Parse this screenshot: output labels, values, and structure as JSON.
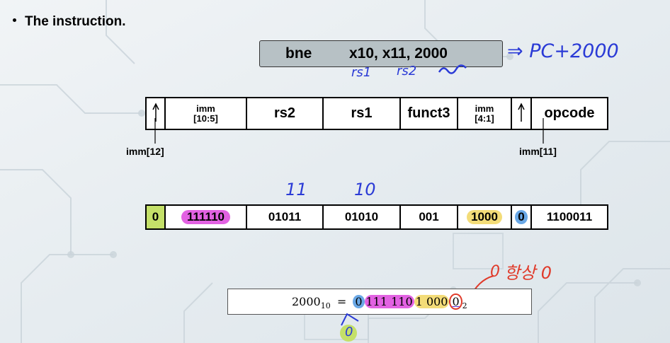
{
  "title": "The instruction.",
  "instruction": {
    "opcode": "bne",
    "operands": "x10, x11, 2000"
  },
  "annotations": {
    "pc_note": "⇒ PC+2000",
    "rs1_note": "rs1",
    "rs2_note": "rs2",
    "reg11_note": "11",
    "reg10_note": "10",
    "always_zero_note": "항상 0",
    "zero_hand": "0",
    "zero_hand_lower": "0"
  },
  "format": {
    "fields": [
      {
        "label": "",
        "arrow": true
      },
      {
        "label_top": "imm",
        "label_bottom": "[10:5]"
      },
      {
        "label": "rs2"
      },
      {
        "label": "rs1"
      },
      {
        "label": "funct3"
      },
      {
        "label_top": "imm",
        "label_bottom": "[4:1]"
      },
      {
        "label": "",
        "arrow": true
      },
      {
        "label": "opcode"
      }
    ],
    "imm12_label": "imm[12]",
    "imm11_label": "imm[11]"
  },
  "encoding": {
    "bits": [
      "0",
      "111110",
      "01011",
      "01010",
      "001",
      "1000",
      "0",
      "1100011"
    ]
  },
  "equation": {
    "lhs": "2000",
    "lhs_base": "10",
    "equals": "=",
    "b1": "0",
    "b2": "111 110",
    "b3": "1 000",
    "b4": "0",
    "rhs_base": "2"
  }
}
